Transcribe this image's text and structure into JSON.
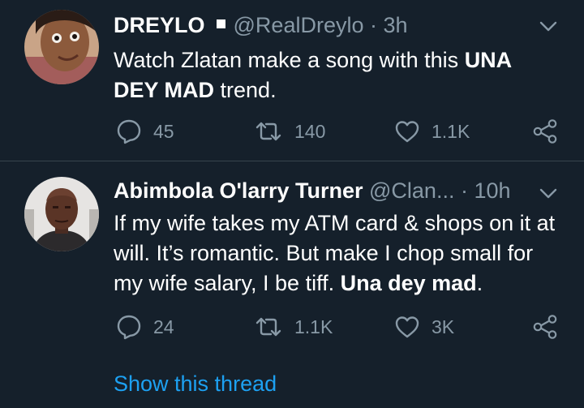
{
  "tweets": [
    {
      "author_name": "DREYLO",
      "handle": "@RealDreylo",
      "separator": "·",
      "time": "3h",
      "text_plain": "Watch Zlatan make a song with this ",
      "text_bold": "UNA DEY MAD",
      "text_tail": " trend.",
      "replies": "45",
      "retweets": "140",
      "likes": "1.1K"
    },
    {
      "author_name": "Abimbola O'larry Turner",
      "handle": "@Clan...",
      "separator": "·",
      "time": "10h",
      "text_plain": "If my wife takes my ATM card & shops on it at will. It’s romantic. But make I chop small for my wife salary, I be tiff. ",
      "text_bold": "Una dey mad",
      "text_tail": ".",
      "replies": "24",
      "retweets": "1.1K",
      "likes": "3K"
    }
  ],
  "thread_link": "Show this thread",
  "icons": {
    "reply": "reply-icon",
    "retweet": "retweet-icon",
    "like": "heart-icon",
    "share": "share-icon",
    "more": "chevron-down-icon"
  },
  "colors": {
    "background": "#15202b",
    "secondary_text": "#8899a6",
    "link": "#1da1f2",
    "divider": "#38444d"
  }
}
